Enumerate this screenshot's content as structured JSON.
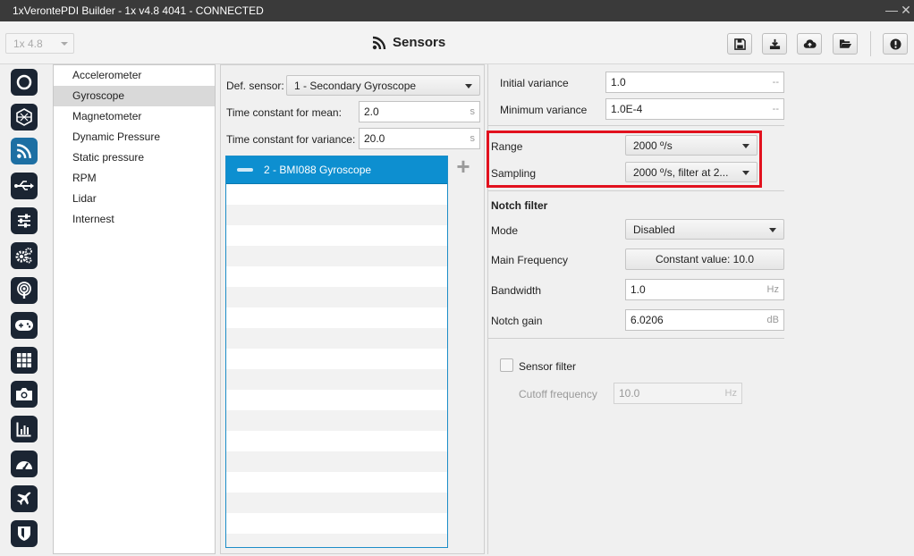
{
  "window": {
    "title": "1xVerontePDI Builder - 1x v4.8 4041 - CONNECTED"
  },
  "toolbar": {
    "version_select": "1x 4.8",
    "page_title": "Sensors",
    "page_icon": "rss-icon",
    "buttons": [
      "save-icon",
      "download-icon",
      "cloud-upload-icon",
      "folder-open-icon",
      "alert-icon"
    ]
  },
  "iconbar": {
    "items": [
      "power-icon",
      "hexagon-icon",
      "rss-icon",
      "usb-icon",
      "sliders-icon",
      "gears-icon",
      "podcast-icon",
      "gamepad-icon",
      "grid-icon",
      "camera-icon",
      "chart-icon",
      "dashboard-icon",
      "plane-icon",
      "shield-icon"
    ],
    "active_index": 2
  },
  "sensor_list": {
    "items": [
      "Accelerometer",
      "Gyroscope",
      "Magnetometer",
      "Dynamic Pressure",
      "Static pressure",
      "RPM",
      "Lidar",
      "Internest"
    ],
    "selected_index": 1
  },
  "middle": {
    "def_sensor_label": "Def. sensor:",
    "def_sensor_value": "1 - Secondary Gyroscope",
    "tc_mean_label": "Time constant for mean:",
    "tc_mean_value": "2.0",
    "tc_mean_unit": "s",
    "tc_var_label": "Time constant for variance:",
    "tc_var_value": "20.0",
    "tc_var_unit": "s",
    "sensor_entry": "2 - BMI088 Gyroscope"
  },
  "right": {
    "initial_variance_label": "Initial variance",
    "initial_variance_value": "1.0",
    "initial_variance_unit": "--",
    "minimum_variance_label": "Minimum variance",
    "minimum_variance_value": "1.0E-4",
    "minimum_variance_unit": "--",
    "range_label": "Range",
    "range_value": "2000 º/s",
    "sampling_label": "Sampling",
    "sampling_value": "2000 º/s, filter at 2...",
    "notch_title": "Notch filter",
    "mode_label": "Mode",
    "mode_value": "Disabled",
    "main_freq_label": "Main Frequency",
    "main_freq_value": "Constant value: 10.0",
    "bandwidth_label": "Bandwidth",
    "bandwidth_value": "1.0",
    "bandwidth_unit": "Hz",
    "notch_gain_label": "Notch gain",
    "notch_gain_value": "6.0206",
    "notch_gain_unit": "dB",
    "sensor_filter_label": "Sensor filter",
    "cutoff_label": "Cutoff frequency",
    "cutoff_value": "10.0",
    "cutoff_unit": "Hz"
  },
  "colors": {
    "accent": "#0d8fd0",
    "highlight": "#e2111e",
    "icon_bg": "#1b2533"
  }
}
